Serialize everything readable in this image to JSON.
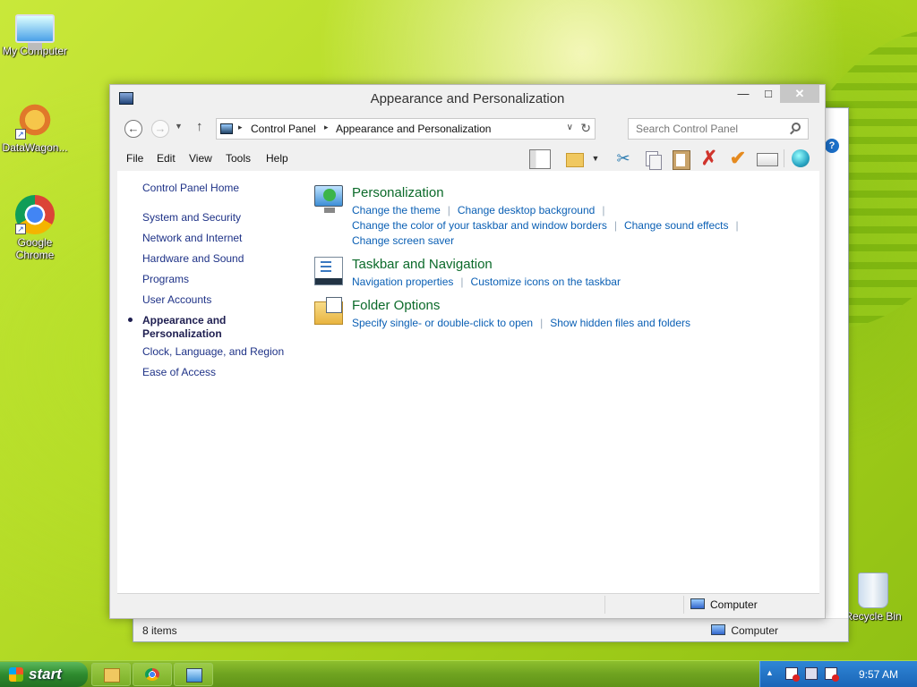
{
  "desktop": {
    "icons": [
      {
        "label": "My Computer"
      },
      {
        "label": "DataWagon..."
      },
      {
        "label": "Google Chrome"
      },
      {
        "label": "Recycle Bin"
      }
    ]
  },
  "back_window": {
    "status_count": "8 items",
    "status_location": "Computer",
    "help_glyph": "?"
  },
  "window": {
    "title": "Appearance and Personalization",
    "controls": {
      "minimize": "—",
      "maximize": "□",
      "close": "✕"
    },
    "nav": {
      "back": "←",
      "forward": "→",
      "recent": "▼",
      "up": "↑"
    },
    "breadcrumb": [
      "Control Panel",
      "Appearance and Personalization"
    ],
    "breadcrumb_sep": "▸",
    "address_dropdown": "∨",
    "refresh": "↻",
    "search_placeholder": "Search Control Panel",
    "menu": [
      "File",
      "Edit",
      "View",
      "Tools",
      "Help"
    ],
    "toolbar": {
      "tool_drop": "▼",
      "cut": "✂",
      "delete": "✗",
      "check": "✔"
    },
    "left_nav": {
      "home": "Control Panel Home",
      "items": [
        "System and Security",
        "Network and Internet",
        "Hardware and Sound",
        "Programs",
        "User Accounts",
        "Appearance and Personalization",
        "Clock, Language, and Region",
        "Ease of Access"
      ],
      "current_index": 5
    },
    "categories": [
      {
        "title": "Personalization",
        "icon": "personalization-icon",
        "links": [
          "Change the theme",
          "Change desktop background",
          "Change the color of your taskbar and window borders",
          "Change sound effects",
          "Change screen saver"
        ]
      },
      {
        "title": "Taskbar and Navigation",
        "icon": "taskbar-icon",
        "links": [
          "Navigation properties",
          "Customize icons on the taskbar"
        ]
      },
      {
        "title": "Folder Options",
        "icon": "folder-options-icon",
        "links": [
          "Specify single- or double-click to open",
          "Show hidden files and folders"
        ]
      }
    ],
    "status_location": "Computer"
  },
  "taskbar": {
    "start_label": "start",
    "tray_arrow": "▲",
    "clock": "9:57 AM"
  }
}
